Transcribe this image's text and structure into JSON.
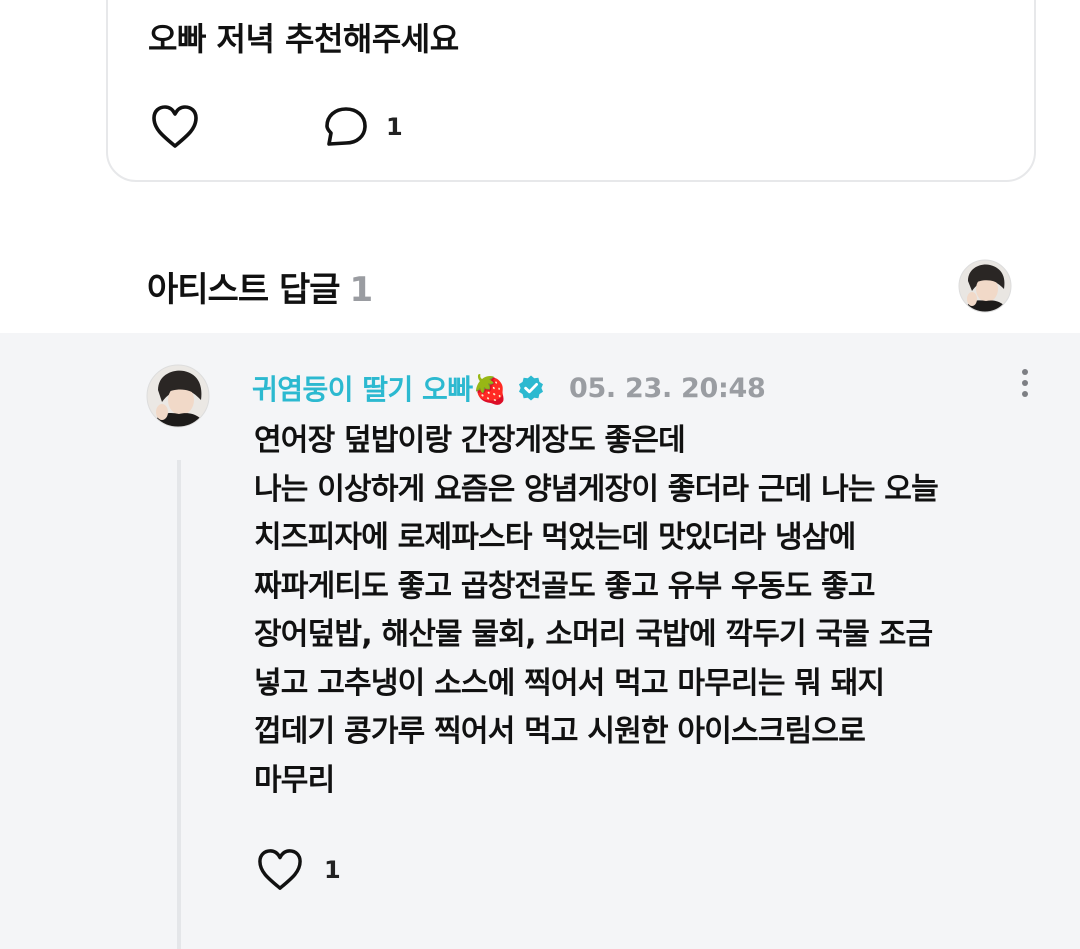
{
  "post": {
    "text": "오빠 저녁 추천해주세요",
    "avatar_deco": "ꕤ",
    "like_icon": "heart-outline-icon",
    "comment_icon": "speech-bubble-icon",
    "comment_count": "1"
  },
  "artist_section": {
    "title": "아티스트 답글",
    "count": "1"
  },
  "reply": {
    "author": "귀염둥이 딸기 오빠🍓",
    "verified_icon": "verified-check-icon",
    "accent_color": "#2cb9d0",
    "timestamp": "05. 23. 20:48",
    "body_lines": [
      "연어장 덮밥이랑 간장게장도 좋은데",
      "나는 이상하게 요즘은 양념게장이 좋더라 근데 나는 오늘",
      "치즈피자에 로제파스타 먹었는데 맛있더라 냉삼에",
      "짜파게티도 좋고 곱창전골도 좋고 유부 우동도 좋고",
      "장어덮밥, 해산물 물회, 소머리 국밥에 깍두기 국물 조금",
      "넣고 고추냉이 소스에 찍어서 먹고 마무리는 뭐 돼지",
      "껍데기 콩가루 찍어서 먹고 시원한 아이스크림으로",
      "마무리"
    ],
    "like_count": "1",
    "more_icon": "more-vertical-icon"
  }
}
